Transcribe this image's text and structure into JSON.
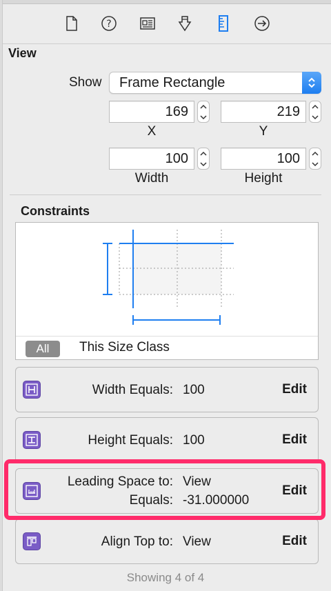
{
  "toolbar": {
    "icons": [
      "file-inspector-icon",
      "help-inspector-icon",
      "identity-inspector-icon",
      "attributes-inspector-icon",
      "size-inspector-icon",
      "connections-inspector-icon"
    ],
    "active_color": "#1e7ef0"
  },
  "view": {
    "title": "View",
    "show_label": "Show",
    "show_value": "Frame Rectangle",
    "x_value": "169",
    "x_label": "X",
    "y_value": "219",
    "y_label": "Y",
    "width_value": "100",
    "width_label": "Width",
    "height_value": "100",
    "height_label": "Height"
  },
  "constraints": {
    "title": "Constraints",
    "filter_all": "All",
    "filter_size_class": "This Size Class",
    "accent": "#1e7ef0",
    "items": [
      {
        "icon": "width-constraint-icon",
        "key1": "Width Equals:",
        "val1": "100",
        "edit": "Edit"
      },
      {
        "icon": "height-constraint-icon",
        "key1": "Height Equals:",
        "val1": "100",
        "edit": "Edit"
      },
      {
        "icon": "leading-space-constraint-icon",
        "key1": "Leading Space to:",
        "val1": "View",
        "key2": "Equals:",
        "val2": "-31.000000",
        "edit": "Edit"
      },
      {
        "icon": "align-top-constraint-icon",
        "key1": "Align Top to:",
        "val1": "View",
        "edit": "Edit"
      }
    ],
    "highlight_color": "#ff2b6a",
    "showing": "Showing 4 of 4"
  }
}
